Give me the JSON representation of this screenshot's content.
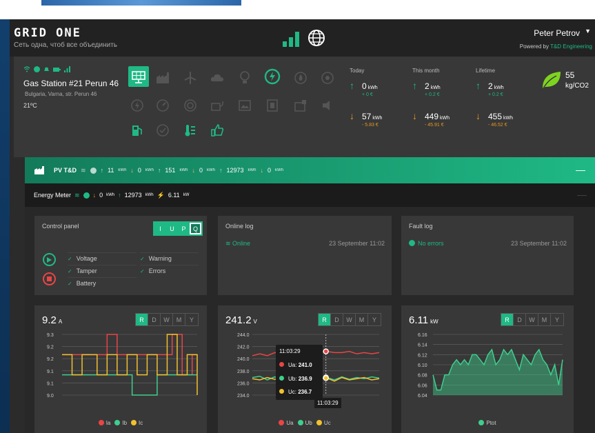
{
  "header": {
    "logo": "GRID ONE",
    "tagline": "Сеть одна, чтоб все объединить",
    "user_name": "Peter Petrov",
    "powered_prefix": "Powered by",
    "powered_brand": "T&D Engineering"
  },
  "station": {
    "name": "Gas Station #21 Perun 46",
    "address": "Bulgaria, Varna, str. Perun 46",
    "temperature": "21ºC",
    "devices": [
      "pv-panel-icon",
      "factory-icon",
      "wind-turbine-icon",
      "cloud-icon",
      "bulb-icon",
      "power-icon",
      "flame-icon",
      "fan-icon",
      "meter-icon",
      "gauge-icon",
      "fan2-icon",
      "plug-icon",
      "picture-icon",
      "board-icon",
      "machine-icon",
      "speaker-icon",
      "fuel-pump-icon",
      "check-circle-icon",
      "thermometer-icon",
      "thumbs-up-icon"
    ],
    "today_label": "Today",
    "month_label": "This month",
    "lifetime_label": "Lifetime",
    "today_in": "0",
    "today_in_money": "+ 0 €",
    "today_out": "57",
    "today_out_money": "- 5.83 €",
    "month_in": "2",
    "month_in_money": "+ 0.2 €",
    "month_out": "449",
    "month_out_money": "- 45.91 €",
    "life_in": "2",
    "life_in_money": "+ 0.2 €",
    "life_out": "455",
    "life_out_money": "- 46.52 €",
    "unit": "kWh",
    "co2_value": "55",
    "co2_unit": "kg/CO2"
  },
  "pv_bar": {
    "name": "PV T&D",
    "v1": "11",
    "v2": "0",
    "v3": "151",
    "v4": "0",
    "v5": "12973",
    "v6": "0",
    "unit": "kWh",
    "unit_big": "kWh"
  },
  "energy_meter": {
    "name": "Energy Meter",
    "v1": "0",
    "v2": "12973",
    "v3": "6.11",
    "unit": "kWh",
    "unit_w": "kW"
  },
  "control_panel": {
    "title": "Control panel",
    "modes": [
      "I",
      "U",
      "P",
      "Q"
    ],
    "checks": [
      "Voltage",
      "Tamper",
      "Battery",
      "Warning",
      "Errors"
    ]
  },
  "online_log": {
    "title": "Online log",
    "status": "Online",
    "time": "23 September 11:02"
  },
  "fault_log": {
    "title": "Fault log",
    "status": "No errors",
    "time": "23 September 11:02"
  },
  "ranges": [
    "R",
    "D",
    "W",
    "M",
    "Y"
  ],
  "chart_data": [
    {
      "type": "line",
      "title": "9.2",
      "unit": "A",
      "ylim": [
        9.0,
        9.3
      ],
      "yticks": [
        "9.3",
        "9.2",
        "9.2",
        "9.1",
        "9.1",
        "9.0"
      ],
      "series": [
        {
          "name": "Ia",
          "color": "#e94545",
          "values": [
            9.2,
            9.2,
            9.2,
            9.2,
            9.2,
            9.2,
            9.2,
            9.2,
            9.2,
            9.3,
            9.3,
            9.2,
            9.2,
            9.2,
            9.2,
            9.2,
            9.2,
            9.2,
            9.2,
            9.2,
            9.2,
            9.2,
            9.3,
            9.3,
            9.1,
            9.1,
            9.2,
            9.2
          ]
        },
        {
          "name": "Ib",
          "color": "#3ecf8e",
          "values": [
            9.1,
            9.1,
            9.1,
            9.1,
            9.1,
            9.1,
            9.1,
            9.1,
            9.1,
            9.1,
            9.1,
            9.1,
            9.1,
            9.1,
            9.0,
            9.0,
            9.0,
            9.0,
            9.0,
            9.1,
            9.1,
            9.1,
            9.1,
            9.1,
            9.1,
            9.1,
            9.1,
            9.1
          ]
        },
        {
          "name": "Ic",
          "color": "#f2c12e",
          "values": [
            9.2,
            9.2,
            9.1,
            9.1,
            9.2,
            9.2,
            9.2,
            9.1,
            9.1,
            9.2,
            9.2,
            9.1,
            9.1,
            9.2,
            9.2,
            9.1,
            9.1,
            9.2,
            9.2,
            9.1,
            9.1,
            9.3,
            9.3,
            9.1,
            9.1,
            9.2,
            9.2,
            9.0
          ]
        }
      ]
    },
    {
      "type": "line",
      "title": "241.2",
      "unit": "V",
      "ylim": [
        234.0,
        244.0
      ],
      "yticks": [
        "244.0",
        "242.0",
        "240.0",
        "238.0",
        "236.0",
        "234.0"
      ],
      "tooltip": {
        "time": "11:03:29",
        "Ua": "241.0",
        "Ub": "236.9",
        "Uc": "236.7"
      },
      "series": [
        {
          "name": "Ua",
          "color": "#e94545",
          "values": [
            240.5,
            240.8,
            240.5,
            241.0,
            240.8,
            241.0,
            241.0,
            241.2,
            241.0,
            241.0,
            241.2,
            241.0,
            241.0,
            241.2,
            240.8,
            241.0,
            240.8,
            241.0
          ]
        },
        {
          "name": "Ub",
          "color": "#3ecf8e",
          "values": [
            236.9,
            237.1,
            236.5,
            237.0,
            236.6,
            236.9,
            237.0,
            236.7,
            237.2,
            236.8,
            236.9,
            236.5,
            237.0,
            236.6,
            236.9,
            236.7,
            237.0,
            236.8
          ]
        },
        {
          "name": "Uc",
          "color": "#f2c12e",
          "values": [
            236.7,
            236.5,
            236.9,
            236.6,
            236.8,
            236.4,
            236.7,
            236.9,
            236.5,
            236.7,
            236.8,
            236.3,
            236.9,
            236.5,
            236.7,
            236.9,
            236.5,
            236.7
          ]
        }
      ]
    },
    {
      "type": "area",
      "title": "6.11",
      "unit": "kW",
      "ylim": [
        6.04,
        6.16
      ],
      "yticks": [
        "6.16",
        "6.14",
        "6.12",
        "6.10",
        "6.08",
        "6.06",
        "6.04"
      ],
      "series": [
        {
          "name": "Ptot",
          "color": "#3ecf8e",
          "values": [
            6.08,
            6.05,
            6.05,
            6.08,
            6.08,
            6.1,
            6.11,
            6.1,
            6.11,
            6.1,
            6.12,
            6.12,
            6.11,
            6.1,
            6.12,
            6.13,
            6.1,
            6.11,
            6.13,
            6.12,
            6.13,
            6.11,
            6.09,
            6.12,
            6.11,
            6.1,
            6.12,
            6.13,
            6.11,
            6.1,
            6.08,
            6.1,
            6.06,
            6.11
          ]
        }
      ]
    }
  ]
}
